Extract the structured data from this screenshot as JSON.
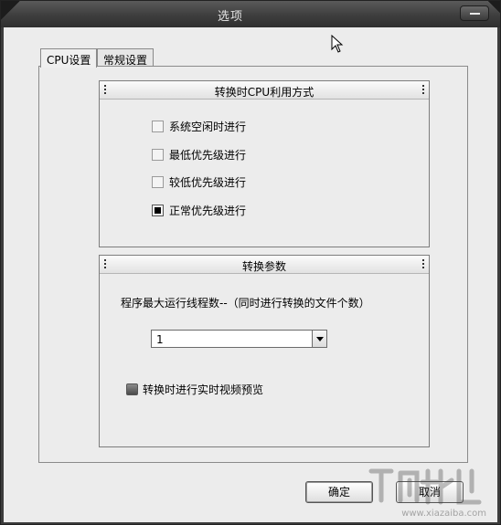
{
  "window": {
    "title": "选项"
  },
  "tabs": [
    {
      "label": "CPU设置",
      "active": true
    },
    {
      "label": "常规设置",
      "active": false
    }
  ],
  "cpu_group": {
    "title": "转换时CPU利用方式",
    "options": [
      {
        "label": "系统空闲时进行",
        "selected": false
      },
      {
        "label": "最低优先级进行",
        "selected": false
      },
      {
        "label": "较低优先级进行",
        "selected": false
      },
      {
        "label": "正常优先级进行",
        "selected": true
      }
    ]
  },
  "param_group": {
    "title": "转换参数",
    "thread_label": "程序最大运行线程数--（同时进行转换的文件个数）",
    "thread_value": "1",
    "preview_label": "转换时进行实时视频预览",
    "preview_checked": false
  },
  "buttons": {
    "ok": "确定",
    "cancel": "取消"
  },
  "watermark": {
    "text": "www.xiazaiba.com"
  },
  "colors": {
    "titlebar": "#3e3e3e",
    "client": "#ececec"
  }
}
